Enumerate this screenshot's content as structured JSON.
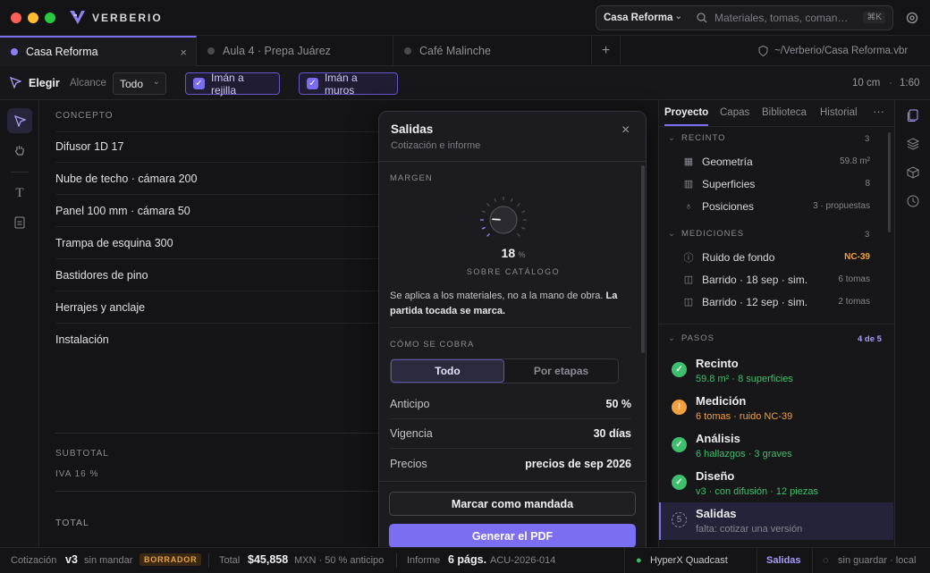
{
  "app": {
    "brand": "VERBERIO"
  },
  "search": {
    "project": "Casa Reforma",
    "placeholder": "Materiales, tomas, coman…",
    "shortcut": "⌘K"
  },
  "tabs": [
    {
      "label": "Casa Reforma"
    },
    {
      "label": "Aula 4 · Prepa Juárez"
    },
    {
      "label": "Café Malinche"
    }
  ],
  "path": "~/Verberio/Casa Reforma.vbr",
  "toolbar": {
    "tool": "Elegir",
    "scope_label": "Alcance",
    "scope_value": "Todo",
    "snap_grid": "Imán a rejilla",
    "snap_walls": "Imán a muros",
    "grid_size": "10 cm",
    "sep": "·",
    "scale": "1:60"
  },
  "table": {
    "header": "CONCEPTO",
    "rows": [
      "Difusor 1D 17",
      "Nube de techo · cámara 200",
      "Panel 100 mm · cámara 50",
      "Trampa de esquina 300",
      "Bastidores de pino",
      "Herrajes y anclaje",
      "Instalación"
    ],
    "subtotal_label": "SUBTOTAL",
    "iva_label": "IVA 16 %",
    "total_label": "TOTAL"
  },
  "modal": {
    "title": "Salidas",
    "subtitle": "Cotización e informe",
    "margin_label": "MARGEN",
    "margin_value": "18",
    "margin_unit": "%",
    "margin_fraction": 0.18,
    "margin_caption": "SOBRE CATÁLOGO",
    "note_normal": "Se aplica a los materiales, no a la mano de obra. ",
    "note_bold": "La partida tocada se marca.",
    "charge_label": "CÓMO SE COBRA",
    "seg_all": "Todo",
    "seg_stages": "Por etapas",
    "rows": [
      {
        "k": "Anticipo",
        "v": "50 %"
      },
      {
        "k": "Vigencia",
        "v": "30 días"
      },
      {
        "k": "Precios",
        "v": "precios de sep 2026"
      }
    ],
    "btn_mark": "Marcar como mandada",
    "btn_pdf": "Generar el PDF"
  },
  "panel": {
    "tabs": [
      "Proyecto",
      "Capas",
      "Biblioteca",
      "Historial"
    ],
    "more": "···",
    "recinto": {
      "label": "RECINTO",
      "count": "3",
      "items": [
        {
          "label": "Geometría",
          "val": "59.8 m²"
        },
        {
          "label": "Superficies",
          "val": "8"
        },
        {
          "label": "Posiciones",
          "val": "3 · propuestas"
        }
      ]
    },
    "mediciones": {
      "label": "MEDICIONES",
      "count": "3",
      "items": [
        {
          "label": "Ruido de fondo",
          "val": "NC-39"
        },
        {
          "label": "Barrido · 18 sep · sim.",
          "val": "6 tomas"
        },
        {
          "label": "Barrido · 12 sep · sim.",
          "val": "2 tomas"
        }
      ]
    },
    "pasos": {
      "label": "PASOS",
      "count": "4 de 5",
      "items": [
        {
          "title": "Recinto",
          "sub": "59.8 m² · 8 superficies"
        },
        {
          "title": "Medición",
          "sub": "6 tomas · ruido NC-39"
        },
        {
          "title": "Análisis",
          "sub": "6 hallazgos · 3 graves"
        },
        {
          "title": "Diseño",
          "sub": "v3 · con difusión · 12 piezas"
        },
        {
          "title": "Salidas",
          "sub": "falta: cotizar una versión",
          "num": "5"
        }
      ]
    }
  },
  "status": {
    "quote_label": "Cotización",
    "version": "v3",
    "sent": "sin mandar",
    "badge": "BORRADOR",
    "total_label": "Total",
    "total": "$45,858",
    "total_suffix": "MXN · 50 % anticipo",
    "report_label": "Informe",
    "pages": "6 págs.",
    "code": "ACU-2026-014",
    "device": "HyperX Quadcast",
    "mode": "Salidas",
    "save": "sin guardar · local"
  },
  "colors": {
    "accent": "#7c6ef0",
    "ok": "#3fbf6e",
    "warn": "#f0a040",
    "badge": "#e8a040"
  }
}
